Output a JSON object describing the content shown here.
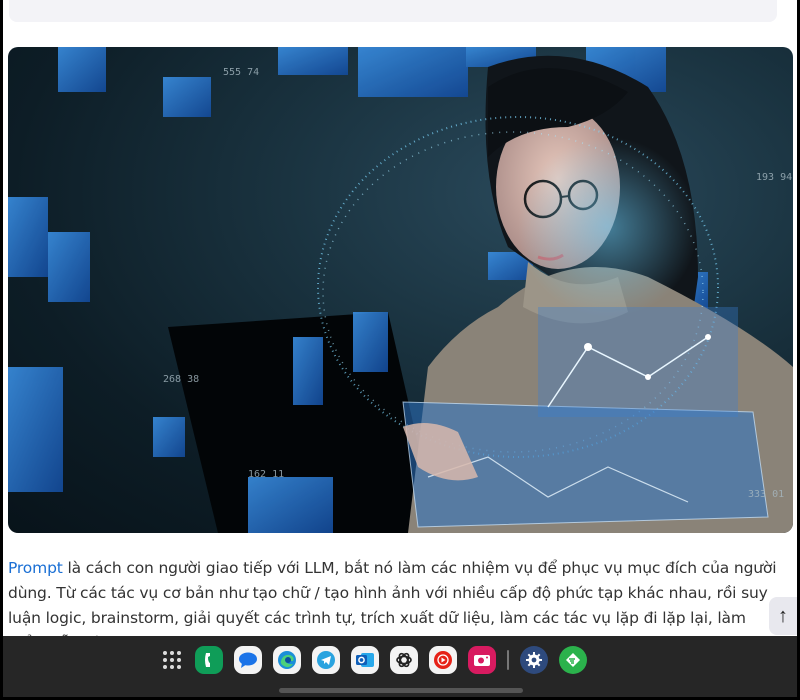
{
  "hero_image": {
    "alt": "Woman wearing glasses looking at a laptop surrounded by holographic data displays",
    "hud_numbers": [
      "555 74",
      "268 38",
      "193 94",
      "333 01",
      "162 11"
    ]
  },
  "article": {
    "link_text": "Prompt",
    "paragraph_rest": " là cách con người giao tiếp với LLM, bắt nó làm các nhiệm vụ để phục vụ mục đích của người dùng. Từ các tác vụ cơ bản như tạo chữ / tạo hình ảnh với nhiều cấp độ phức tạp khác nhau, rồi suy luận logic, brainstorm, giải quyết các trình tự, trích xuất dữ liệu, làm các tác vụ lặp đi lặp lại, làm biểu mẫu hàng loạt..."
  },
  "scroll_top_button": {
    "icon": "arrow-up-icon",
    "glyph": "↑"
  },
  "taskbar": {
    "apps": [
      {
        "name": "apps-drawer",
        "icon": "grid-icon"
      },
      {
        "name": "phone",
        "icon": "phone-icon",
        "color": "#0f9d58"
      },
      {
        "name": "messages",
        "icon": "chat-bubble-icon",
        "color": "#1a73e8"
      },
      {
        "name": "edge",
        "icon": "edge-icon",
        "color": "#1b8fd8"
      },
      {
        "name": "telegram",
        "icon": "telegram-icon",
        "color": "#2aa3df"
      },
      {
        "name": "outlook",
        "icon": "outlook-icon",
        "color": "#1266c4"
      },
      {
        "name": "chatgpt",
        "icon": "chatgpt-icon",
        "color": "#222222"
      },
      {
        "name": "youtube-music",
        "icon": "youtube-music-icon",
        "color": "#e62117"
      },
      {
        "name": "camera",
        "icon": "camera-icon",
        "color": "#d81b60"
      },
      {
        "name": "settings",
        "icon": "gear-icon",
        "color": "#2e4a7d"
      },
      {
        "name": "feedly",
        "icon": "feedly-icon",
        "color": "#2bb24c"
      }
    ]
  }
}
